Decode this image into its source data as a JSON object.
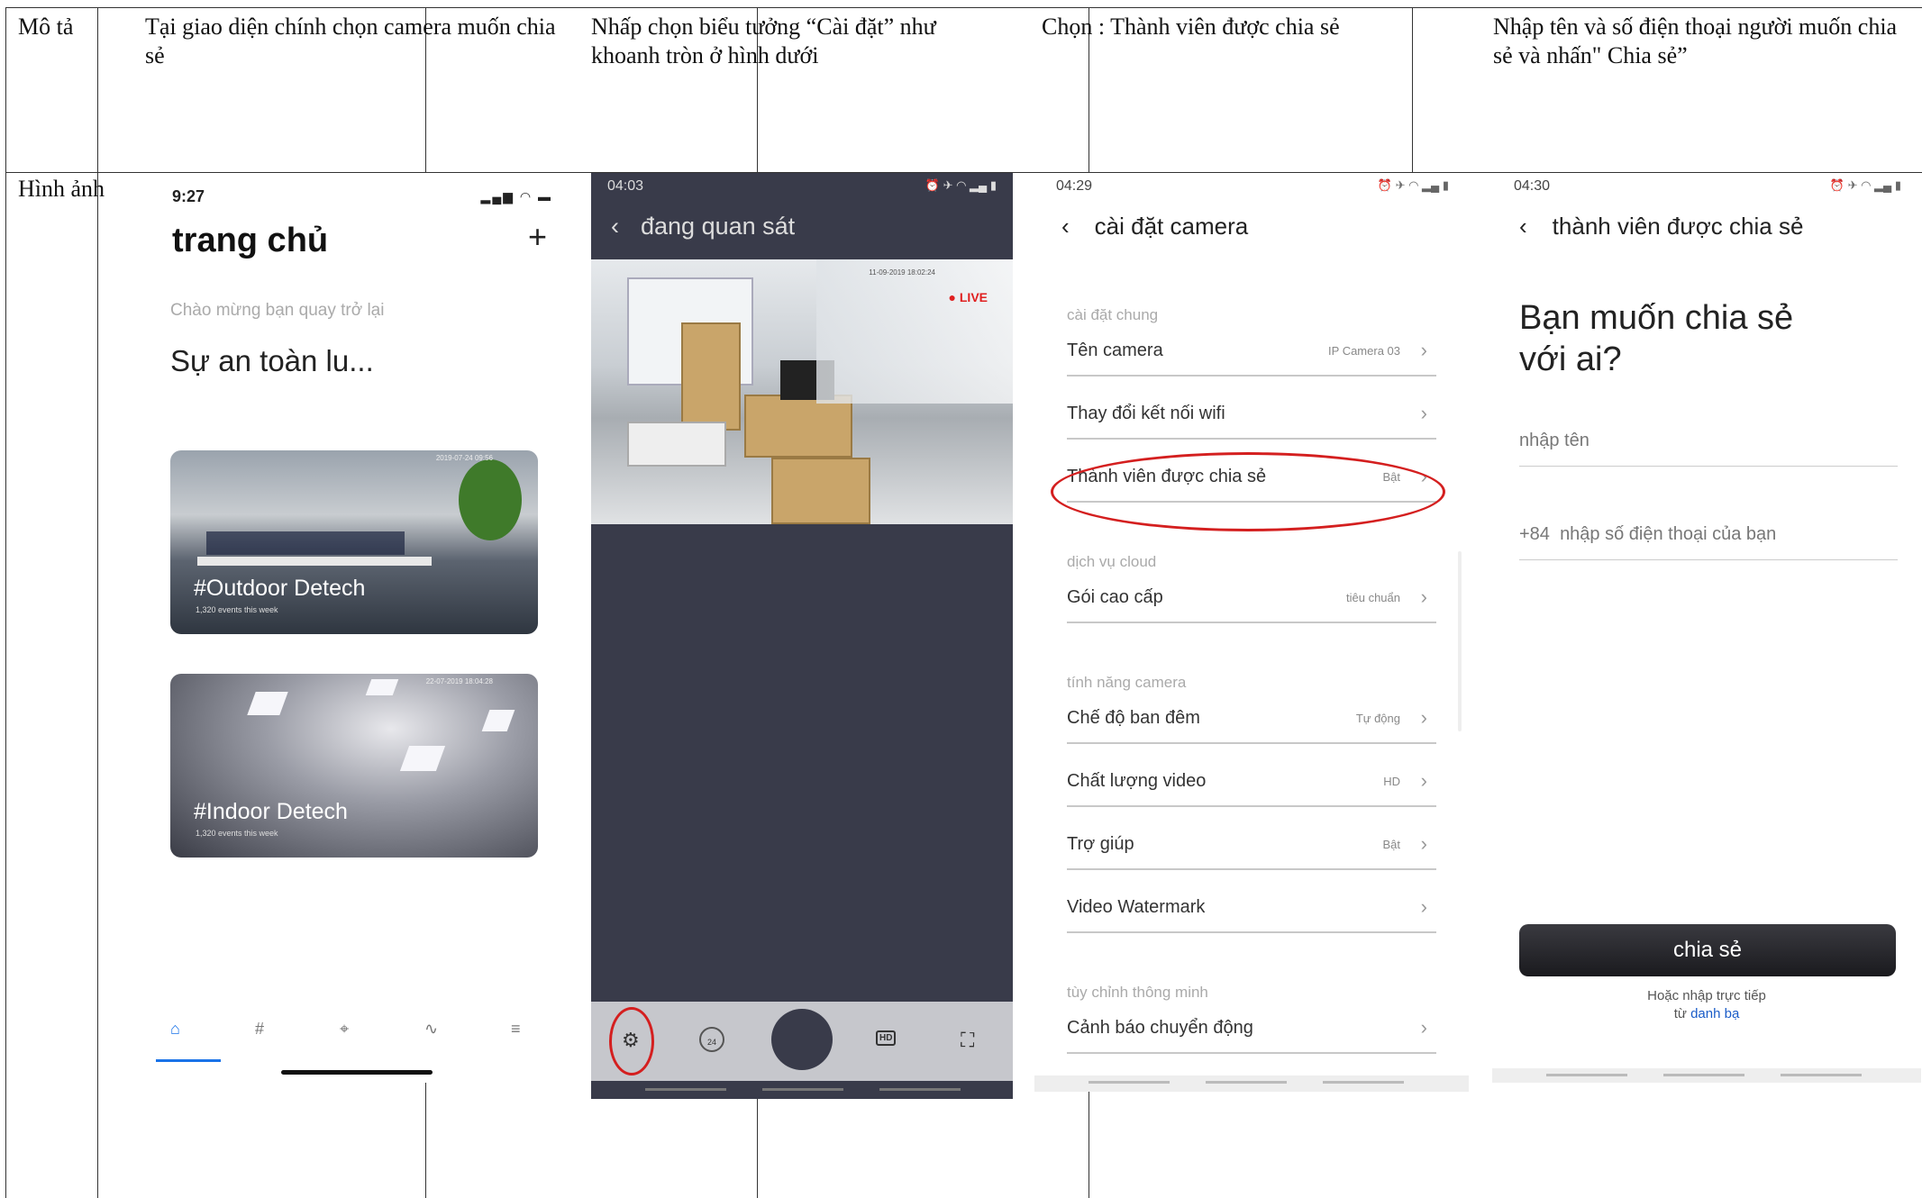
{
  "table": {
    "row1_header": "Mô tả",
    "row2_header": "Hình ảnh",
    "desc1": "Tại giao diện chính chọn camera muốn chia sẻ",
    "desc2": "Nhấp chọn biểu tưởng “Cài đặt” như khoanh tròn ở hình dưới",
    "desc3": "Chọn : Thành viên được chia sẻ",
    "desc4": "Nhập tên và số điện thoại người muốn chia sẻ và nhấn\" Chia sẻ”"
  },
  "screen1": {
    "time": "9:27",
    "title": "trang chủ",
    "add_icon": "+",
    "welcome": "Chào mừng bạn quay trở lại",
    "headline": "Sự an toàn lu...",
    "cameras": [
      {
        "name": "#Outdoor Detech",
        "events": "1,320 events this week",
        "timestamp": "2019-07-24 09:56"
      },
      {
        "name": "#Indoor Detech",
        "events": "1,320 events this week",
        "timestamp": "22-07-2019 18:04:28"
      }
    ],
    "tabs": [
      "home-icon",
      "hashtag-icon",
      "target-icon",
      "activity-icon",
      "menu-icon"
    ],
    "accent": "#1a73e8"
  },
  "screen2": {
    "time": "04:03",
    "title": "đang quan sát",
    "live": "LIVE",
    "video_timestamp": "11-09-2019 18:02:24",
    "controls": [
      "gear-icon",
      "24h-replay-icon",
      "shutter-button",
      "hd-icon",
      "fullscreen-icon"
    ],
    "hd_label": "HD",
    "replay_label": "24"
  },
  "screen3": {
    "time": "04:29",
    "title": "cài đặt camera",
    "sections": {
      "general": "cài đặt chung",
      "cloud": "dịch vụ cloud",
      "features": "tính năng camera",
      "smart": "tùy chỉnh thông minh"
    },
    "rows": [
      {
        "label": "Tên camera",
        "value": "IP Camera 03"
      },
      {
        "label": "Thay đổi kết nối wifi",
        "value": ""
      },
      {
        "label": "Thành viên được chia sẻ",
        "value": "Bật"
      },
      {
        "label": "Gói cao cấp",
        "value": "tiêu chuẩn"
      },
      {
        "label": "Chế độ ban đêm",
        "value": "Tự động"
      },
      {
        "label": "Chất lượng video",
        "value": "HD"
      },
      {
        "label": "Trợ giúp",
        "value": "Bật"
      },
      {
        "label": "Video Watermark",
        "value": ""
      },
      {
        "label": "Cảnh báo chuyển động",
        "value": ""
      }
    ],
    "highlight_color": "#d41f1f"
  },
  "screen4": {
    "time": "04:30",
    "title": "thành viên được chia sẻ",
    "question": "Bạn muốn chia sẻ với ai?",
    "name_placeholder": "nhập tên",
    "phone_prefix": "+84",
    "phone_placeholder": "nhập số điện thoại của bạn",
    "share_button": "chia sẻ",
    "alt_text": "Hoặc nhập trực tiếp",
    "alt_prefix": "từ",
    "alt_link": "danh bạ"
  }
}
